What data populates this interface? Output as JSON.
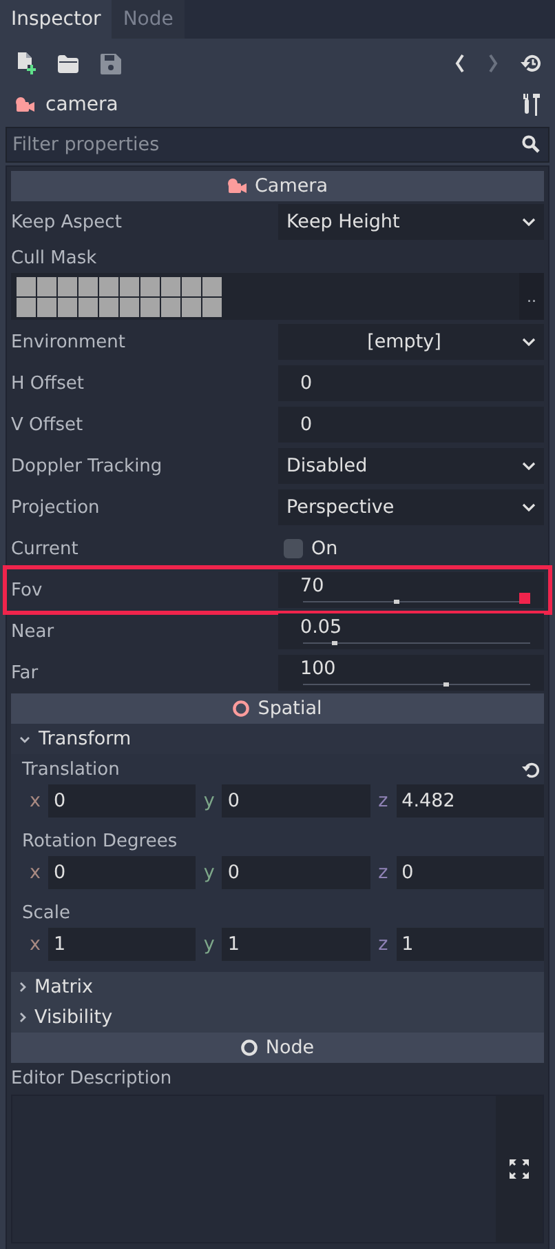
{
  "tabs": [
    {
      "label": "Inspector",
      "selected": true
    },
    {
      "label": "Node",
      "selected": false
    }
  ],
  "object": {
    "name": "camera"
  },
  "filter": {
    "placeholder": "Filter properties"
  },
  "categories": [
    {
      "title": "Camera",
      "kind": "camera",
      "color": "#fc9c9c",
      "items": [
        {
          "kind": "enum",
          "label": "Keep Aspect",
          "value": "Keep Height"
        },
        {
          "kind": "mask",
          "label": "Cull Mask",
          "layers": [
            false,
            false,
            false,
            false,
            false,
            false,
            false,
            false,
            false,
            false,
            false,
            false,
            false,
            false,
            false,
            false,
            false,
            false,
            false,
            false
          ],
          "button": ".."
        },
        {
          "kind": "resource",
          "label": "Environment",
          "value": "[empty]"
        },
        {
          "kind": "number",
          "label": "H Offset",
          "value": "0"
        },
        {
          "kind": "number",
          "label": "V Offset",
          "value": "0"
        },
        {
          "kind": "enum",
          "label": "Doppler Tracking",
          "value": "Disabled"
        },
        {
          "kind": "enum",
          "label": "Projection",
          "value": "Perspective"
        },
        {
          "kind": "check",
          "label": "Current",
          "checked": false,
          "text": "On"
        },
        {
          "kind": "slider",
          "label": "Fov",
          "value": "70",
          "level": 0.4,
          "highlighted": true
        },
        {
          "kind": "slider",
          "label": "Near",
          "value": "0.05",
          "level": 0.13,
          "highlighted": false
        },
        {
          "kind": "slider",
          "label": "Far",
          "value": "100",
          "level": 0.62,
          "highlighted": false
        }
      ]
    },
    {
      "title": "Spatial",
      "kind": "ring",
      "color": "#fc9c9c",
      "items": [
        {
          "kind": "group",
          "label": "Transform",
          "expanded": true,
          "children": [
            {
              "kind": "vector3",
              "label": "Translation",
              "revertable": true,
              "values": [
                {
                  "axis": "x",
                  "value": "0"
                },
                {
                  "axis": "y",
                  "value": "0"
                },
                {
                  "axis": "z",
                  "value": "4.482"
                }
              ]
            },
            {
              "kind": "vector3",
              "label": "Rotation Degrees",
              "revertable": false,
              "values": [
                {
                  "axis": "x",
                  "value": "0"
                },
                {
                  "axis": "y",
                  "value": "0"
                },
                {
                  "axis": "z",
                  "value": "0"
                }
              ]
            },
            {
              "kind": "vector3",
              "label": "Scale",
              "revertable": false,
              "values": [
                {
                  "axis": "x",
                  "value": "1"
                },
                {
                  "axis": "y",
                  "value": "1"
                },
                {
                  "axis": "z",
                  "value": "1"
                }
              ]
            }
          ]
        },
        {
          "kind": "group",
          "label": "Matrix",
          "expanded": false
        },
        {
          "kind": "group",
          "label": "Visibility",
          "expanded": false
        }
      ]
    },
    {
      "title": "Node",
      "kind": "ring",
      "color": "#e0e0e0",
      "items": [
        {
          "kind": "textarea",
          "label": "Editor Description"
        }
      ]
    }
  ]
}
